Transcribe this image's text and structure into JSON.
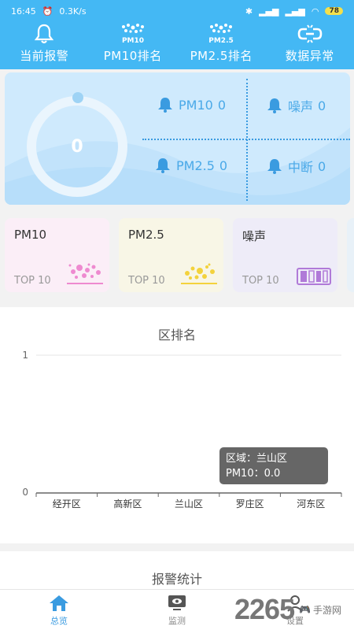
{
  "status_bar": {
    "time": "16:45",
    "speed": "0.3K/s",
    "battery": "78"
  },
  "nav": [
    {
      "label": "当前报警",
      "icon": "bell-icon"
    },
    {
      "label": "PM10排名",
      "icon": "pm10-particles-icon",
      "icon_text": "PM10"
    },
    {
      "label": "PM2.5排名",
      "icon": "pm25-particles-icon",
      "icon_text": "PM2.5"
    },
    {
      "label": "数据异常",
      "icon": "broken-link-icon"
    }
  ],
  "summary": {
    "total": "0",
    "metrics": [
      {
        "label": "PM10",
        "value": "0"
      },
      {
        "label": "噪声",
        "value": "0"
      },
      {
        "label": "PM2.5",
        "value": "0"
      },
      {
        "label": "中断",
        "value": "0"
      }
    ]
  },
  "categories": [
    {
      "title": "PM10",
      "sub": "TOP 10",
      "bg": "#fbeef7"
    },
    {
      "title": "PM2.5",
      "sub": "TOP 10",
      "bg": "#f8f6e6"
    },
    {
      "title": "噪声",
      "sub": "TOP 10",
      "bg": "#eeecf8"
    }
  ],
  "ranking": {
    "title": "区排名",
    "tooltip_line1": "区域：兰山区",
    "tooltip_line2": "PM10：0.0"
  },
  "chart_data": {
    "type": "bar",
    "title": "区排名",
    "categories": [
      "经开区",
      "高新区",
      "兰山区",
      "罗庄区",
      "河东区"
    ],
    "series": [
      {
        "name": "PM10",
        "values": [
          0,
          0,
          0,
          0,
          0
        ]
      }
    ],
    "ylim": [
      0,
      1
    ],
    "yticks": [
      "0",
      "1"
    ],
    "grid": true
  },
  "alarm_stats": {
    "title": "报警统计"
  },
  "tabbar": [
    {
      "label": "总览",
      "icon": "home-icon",
      "active": true
    },
    {
      "label": "监测",
      "icon": "monitor-icon",
      "active": false
    },
    {
      "label": "设置",
      "icon": "user-icon",
      "active": false
    }
  ],
  "watermark": {
    "number": "2265",
    "text": "手游网"
  }
}
